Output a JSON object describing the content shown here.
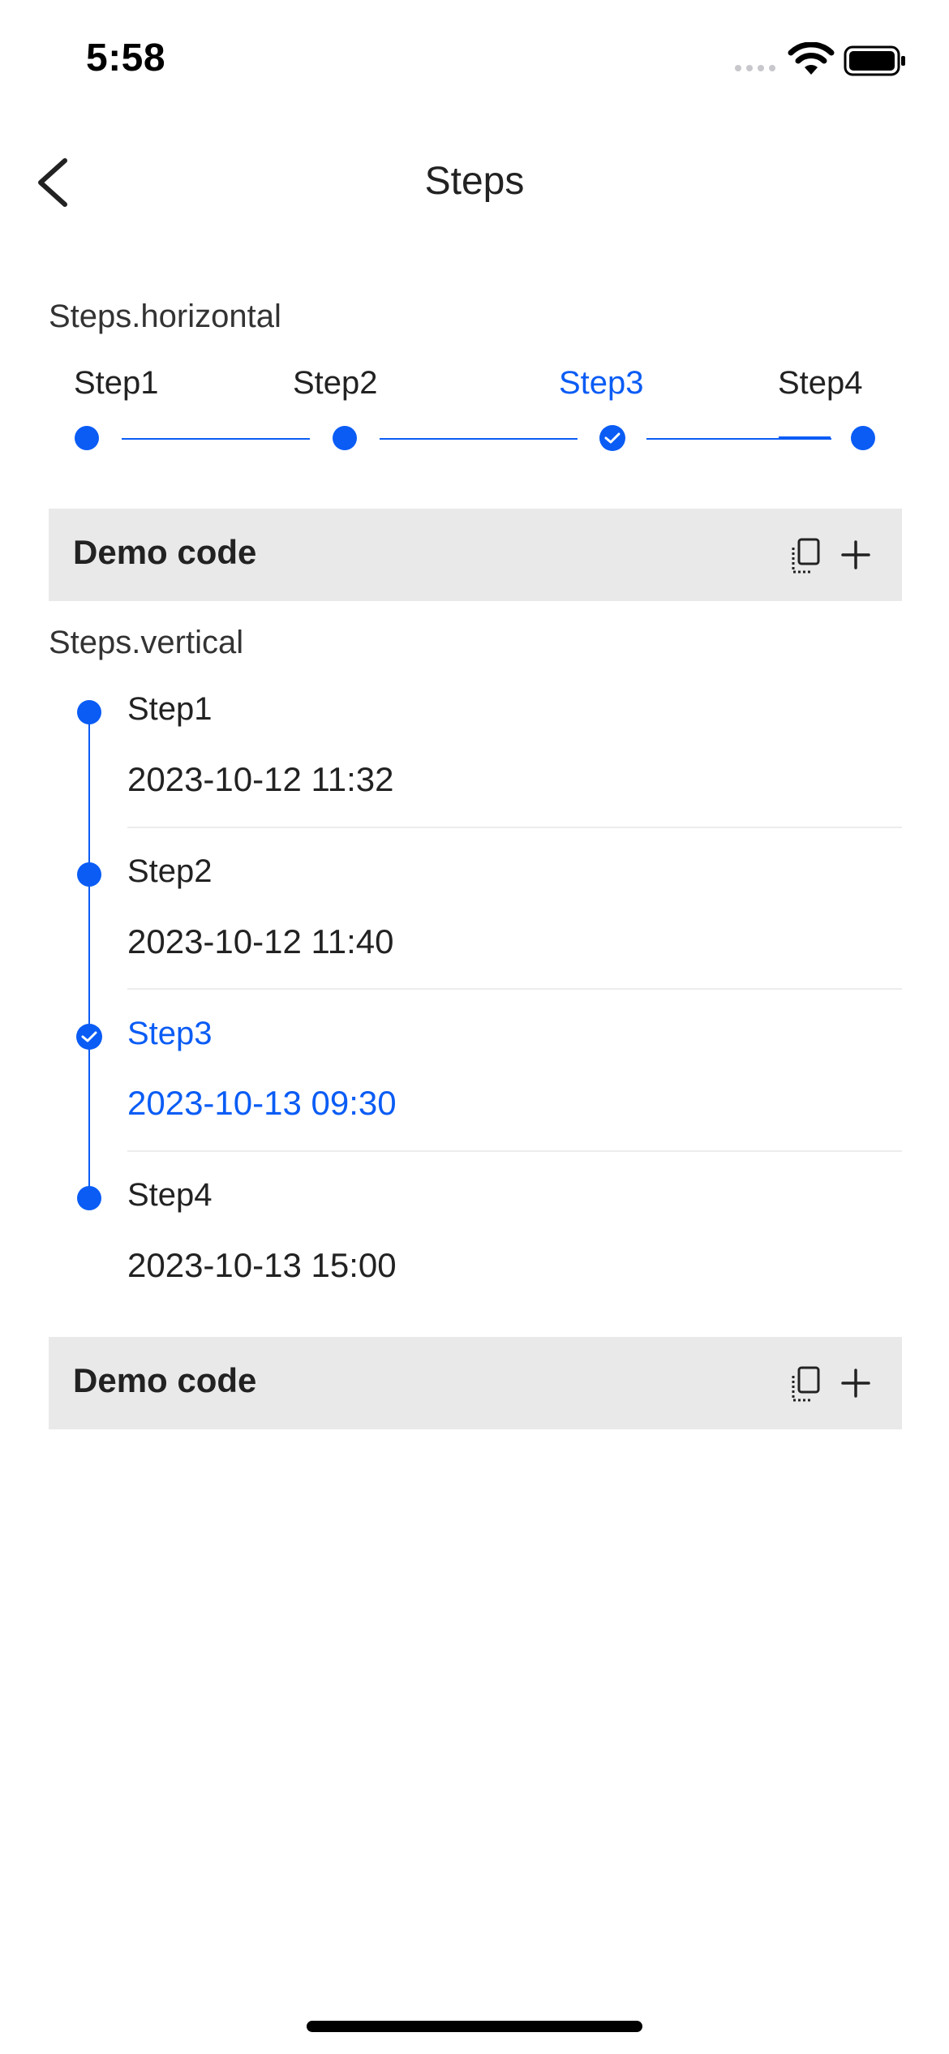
{
  "status_bar": {
    "time": "5:58"
  },
  "nav": {
    "title": "Steps"
  },
  "horizontal": {
    "section_label": "Steps.horizontal",
    "steps": [
      {
        "label": "Step1",
        "state": "done"
      },
      {
        "label": "Step2",
        "state": "done"
      },
      {
        "label": "Step3",
        "state": "current"
      },
      {
        "label": "Step4",
        "state": "done"
      }
    ]
  },
  "demo_code": {
    "label": "Demo code"
  },
  "vertical": {
    "section_label": "Steps.vertical",
    "steps": [
      {
        "label": "Step1",
        "time": "2023-10-12 11:32",
        "state": "done"
      },
      {
        "label": "Step2",
        "time": "2023-10-12 11:40",
        "state": "done"
      },
      {
        "label": "Step3",
        "time": "2023-10-13 09:30",
        "state": "current"
      },
      {
        "label": "Step4",
        "time": "2023-10-13 15:00",
        "state": "done"
      }
    ]
  },
  "colors": {
    "accent": "#0a5cf5",
    "demo_bg": "#e9e9e9",
    "text": "#222222"
  }
}
